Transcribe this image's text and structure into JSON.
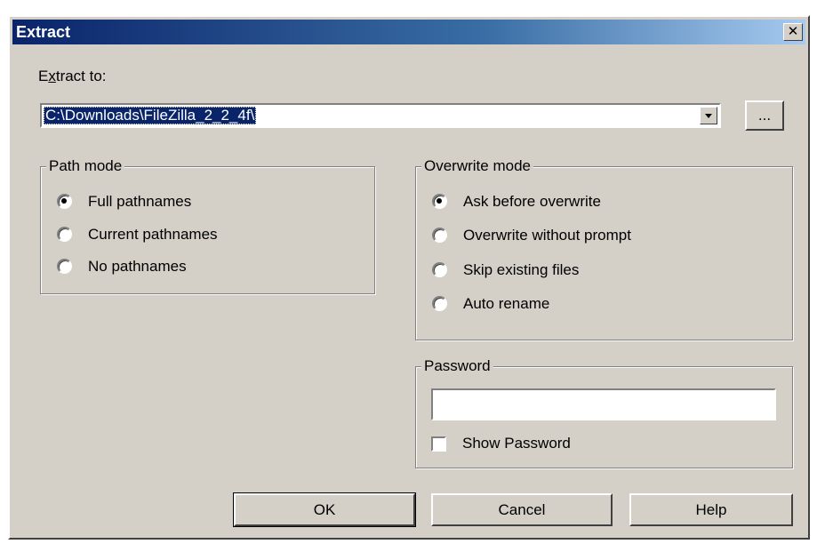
{
  "window": {
    "title": "Extract",
    "close_glyph": "✕"
  },
  "extract_to": {
    "label_prefix": "E",
    "label_mnemonic": "x",
    "label_suffix": "tract to:",
    "value": "C:\\Downloads\\FileZilla_2_2_4f\\",
    "browse_label": "..."
  },
  "path_mode": {
    "title": "Path mode",
    "options": [
      {
        "label": "Full pathnames",
        "checked": true
      },
      {
        "label": "Current pathnames",
        "checked": false
      },
      {
        "label": "No pathnames",
        "checked": false
      }
    ]
  },
  "overwrite_mode": {
    "title": "Overwrite mode",
    "options": [
      {
        "label": "Ask before overwrite",
        "checked": true
      },
      {
        "label": "Overwrite without prompt",
        "checked": false
      },
      {
        "label": "Skip existing files",
        "checked": false
      },
      {
        "label": "Auto rename",
        "checked": false
      }
    ]
  },
  "password": {
    "title": "Password",
    "value": "",
    "show_password_label": "Show Password",
    "show_password_checked": false
  },
  "buttons": {
    "ok": "OK",
    "cancel": "Cancel",
    "help": "Help"
  }
}
